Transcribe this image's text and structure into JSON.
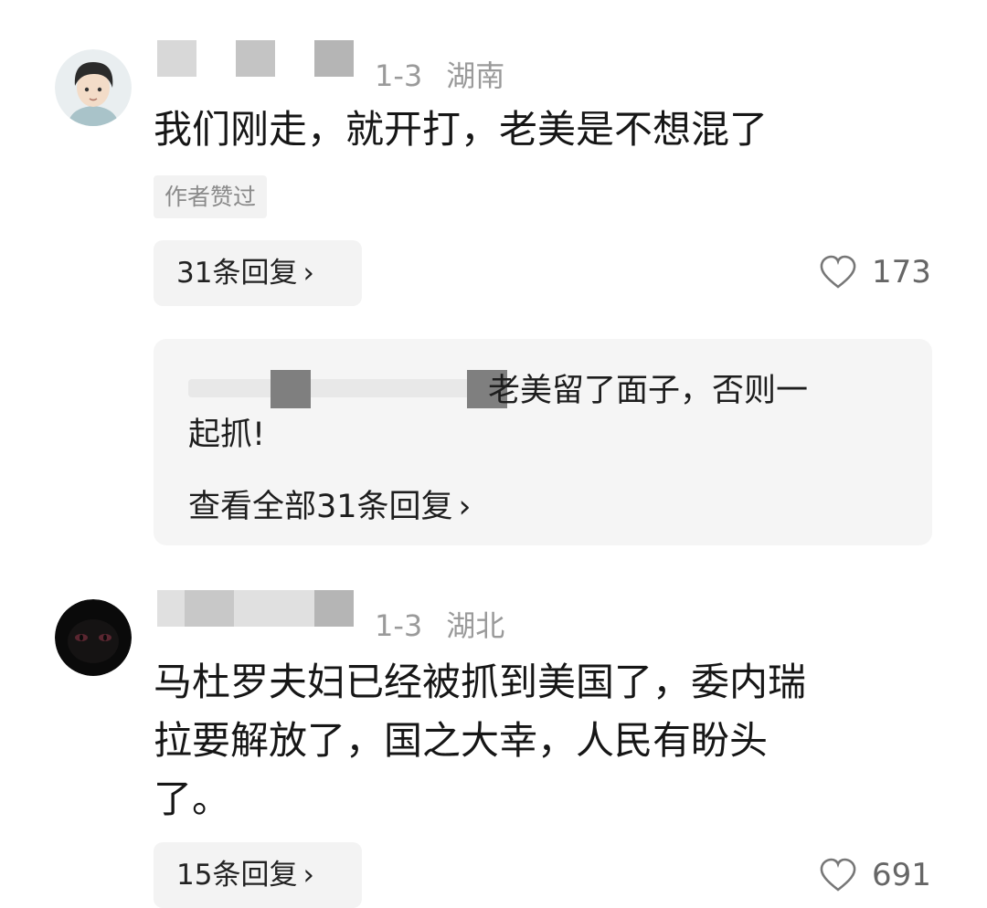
{
  "comments": [
    {
      "avatar_icon": "cartoon-boy-avatar-icon",
      "date": "1-3",
      "location": "湖南",
      "text_lines": [
        "我们刚走，就开打，老美是不想混了"
      ],
      "tag": "作者赞过",
      "reply_button": "31条回复",
      "like_icon": "heart-outline-icon",
      "likes": "173",
      "preview_reply": {
        "text_lines": [
          "老美留了面子，否则一",
          "起抓!"
        ],
        "view_all": "查看全部31条回复"
      }
    },
    {
      "avatar_icon": "dark-cat-eyes-avatar-icon",
      "date": "1-3",
      "location": "湖北",
      "text_lines": [
        "马杜罗夫妇已经被抓到美国了，委内瑞",
        "拉要解放了，国之大幸，人民有盼头",
        "了。"
      ],
      "reply_button": "15条回复",
      "like_icon": "heart-outline-icon",
      "likes": "691"
    }
  ],
  "chevron_glyph": "›",
  "colors": {
    "meta": "#9a9a9a",
    "tag_bg": "#f2f2f2",
    "reply_bg": "#f5f5f5",
    "heart": "#777777"
  }
}
